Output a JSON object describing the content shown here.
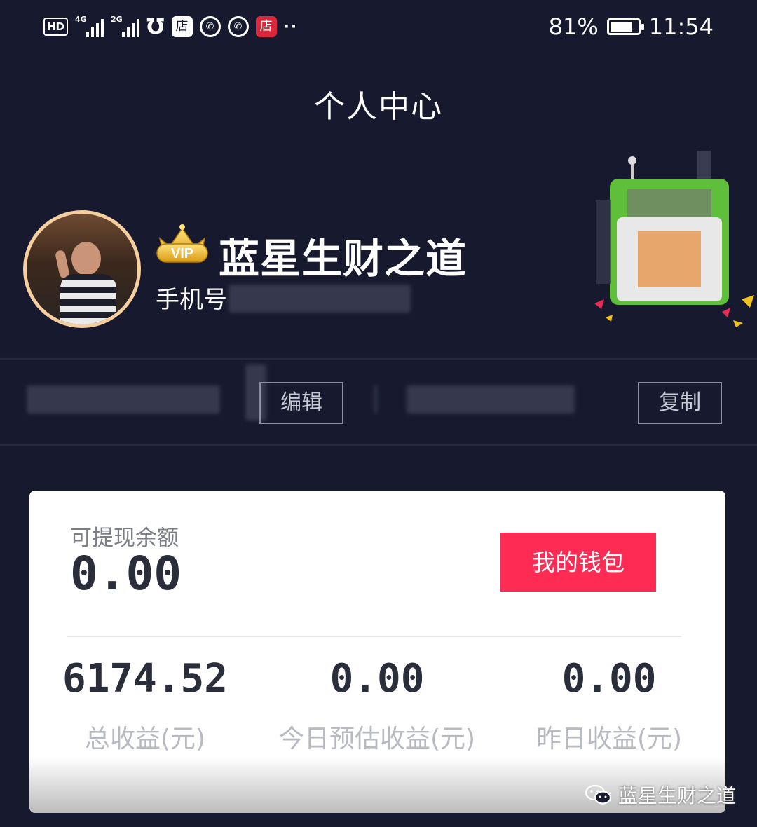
{
  "status_bar": {
    "hd": "HD",
    "net1": "4G",
    "net2": "2G",
    "app_icon_1": "店",
    "app_icon_2": "店",
    "dots": "··",
    "battery_percent": "81%",
    "battery_level": 0.81,
    "time": "11:54",
    "icons": [
      "hd-icon",
      "signal-4g-icon",
      "signal-2g-icon",
      "u-icon",
      "store-icon",
      "whatsapp-icon",
      "whatsapp-icon",
      "store-red-icon",
      "more-dots-icon"
    ]
  },
  "header": {
    "title": "个人中心"
  },
  "profile": {
    "username": "蓝星生财之道",
    "vip_badge": "VIP",
    "phone_label": "手机号"
  },
  "actions": {
    "edit_label": "编辑",
    "copy_label": "复制"
  },
  "earnings": {
    "balance_label": "可提现余额",
    "balance_value": "0.00",
    "wallet_button": "我的钱包",
    "stats": [
      {
        "value": "6174.52",
        "label": "总收益(元)"
      },
      {
        "value": "0.00",
        "label": "今日预估收益(元)"
      },
      {
        "value": "0.00",
        "label": "昨日收益(元)"
      }
    ]
  },
  "watermark": {
    "text": "蓝星生财之道"
  },
  "colors": {
    "background": "#171a2e",
    "accent": "#fe2c55",
    "card": "#ffffff",
    "avatar_ring": "#f5cfa0"
  }
}
